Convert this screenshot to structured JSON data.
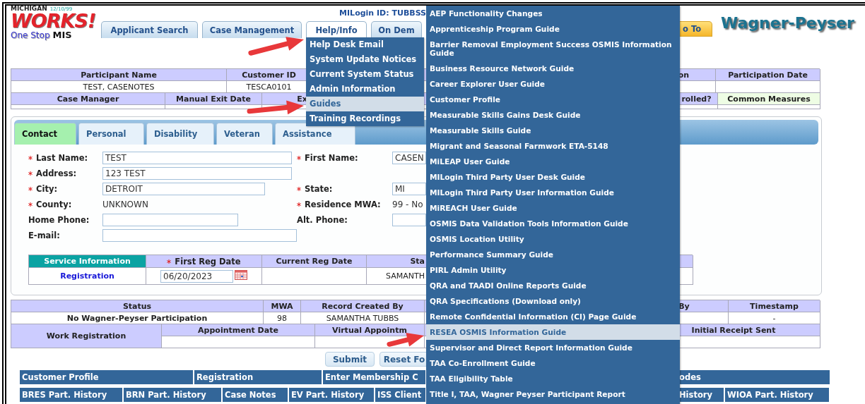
{
  "header": {
    "logo": {
      "state": "MICHIGAN",
      "version": "12/10/99",
      "brand": "WORKS!",
      "one_stop": "One Stop",
      "mis": "MIS"
    },
    "login_id": "MILogin ID: TUBBSS",
    "nav_tabs": [
      {
        "label": "Applicant Search",
        "selected": false
      },
      {
        "label": "Case Management",
        "selected": false
      },
      {
        "label": "Help/Info",
        "selected": true
      },
      {
        "label": "On Dem",
        "selected": false
      }
    ],
    "goto_button": "o To",
    "program_title": "Wagner-Peyser"
  },
  "participant_table": {
    "rows": [
      {
        "kind": "head",
        "cells": [
          "Participant Name",
          "Customer ID",
          "",
          "",
          "on",
          "Participation Date"
        ]
      },
      {
        "kind": "value",
        "cells": [
          "TEST, CASENOTES",
          "TESCA0101",
          "",
          "",
          "",
          ""
        ]
      },
      {
        "kind": "head",
        "cells": [
          "Case Manager",
          "Manual Exit Date",
          "Ex",
          "",
          "rolled?",
          {
            "text": "Common Measures",
            "highlight": true
          }
        ]
      },
      {
        "kind": "value",
        "cells": [
          "",
          "",
          "",
          "",
          "",
          ""
        ]
      }
    ]
  },
  "contact_tabs": [
    {
      "label": "Contact",
      "selected": true
    },
    {
      "label": "Personal",
      "selected": false
    },
    {
      "label": "Disability",
      "selected": false
    },
    {
      "label": "Veteran",
      "selected": false
    },
    {
      "label": "Assistance",
      "selected": false
    }
  ],
  "contact_form": [
    {
      "fields": [
        {
          "label": "Last Name:",
          "required": true,
          "kind": "input",
          "value": "TEST"
        },
        {
          "label": "First Name:",
          "required": true,
          "kind": "input",
          "value": "CASEN"
        }
      ]
    },
    {
      "fields": [
        {
          "label": "Address:",
          "required": true,
          "kind": "input",
          "value": "123 TEST"
        }
      ]
    },
    {
      "fields": [
        {
          "label": "City:",
          "required": true,
          "kind": "input",
          "value": "DETROIT"
        },
        {
          "label": "State:",
          "required": true,
          "kind": "input",
          "value": "MI"
        }
      ]
    },
    {
      "fields": [
        {
          "label": "County:",
          "required": true,
          "kind": "text",
          "value": "UNKNOWN"
        },
        {
          "label": "Residence MWA:",
          "required": true,
          "kind": "text",
          "value": "99 - No"
        }
      ]
    },
    {
      "fields": [
        {
          "label": "Home Phone:",
          "required": false,
          "kind": "input"
        },
        {
          "label": "Alt. Phone:",
          "required": false,
          "kind": "input"
        }
      ]
    },
    {
      "fields": [
        {
          "label": "E-mail:",
          "required": false,
          "kind": "input"
        }
      ]
    }
  ],
  "service_table": {
    "rows": [
      {
        "kind": "head",
        "cells": [
          {
            "text": "Service Information",
            "highlight": true
          },
          {
            "text": "First Reg Date",
            "required": true
          },
          "Current Reg Date",
          "Sta",
          ""
        ]
      },
      {
        "kind": "value",
        "cells": [
          {
            "text": "Registration",
            "kind": "link"
          },
          {
            "text": "06/20/2023",
            "kind": "date"
          },
          "",
          "SAMANTH",
          ""
        ]
      }
    ]
  },
  "status_table": {
    "rows": [
      {
        "kind": "head",
        "cells": [
          "Status",
          "MWA",
          "Record Created By",
          "",
          "By",
          "Timestamp"
        ]
      },
      {
        "kind": "value",
        "cells": [
          {
            "text": "No Wagner-Peyser Participation",
            "bold": true
          },
          "98",
          "SAMANTHA TUBBS",
          "",
          "",
          "-"
        ]
      }
    ]
  },
  "work_registration": {
    "label": "Work Registration",
    "headers_left": [
      "Appointment Date",
      "Virtual Appointm"
    ],
    "headers_right": [
      "Initial Receipt Sent"
    ]
  },
  "buttons": [
    "Submit",
    "Reset Fo"
  ],
  "nav_rows": [
    [
      "Customer Profile",
      "Registration",
      "Enter Membership C",
      "",
      "odes"
    ],
    [
      "BRES Part. History",
      "BRN Part. History",
      "Case Notes",
      "EV Part. History",
      "ISS Client",
      "",
      "History",
      "WIOA Part. History"
    ]
  ],
  "help_menu": [
    {
      "label": "Help Desk Email",
      "selected": false
    },
    {
      "label": "System Update Notices",
      "selected": false
    },
    {
      "label": "Current System Status",
      "selected": false
    },
    {
      "label": "Admin Information",
      "selected": false
    },
    {
      "label": "Guides",
      "selected": true
    },
    {
      "label": "Training Recordings",
      "selected": false
    }
  ],
  "guides_menu": [
    {
      "label": "AEP Functionality Changes",
      "selected": false
    },
    {
      "label": "Apprenticeship Program Guide",
      "selected": false
    },
    {
      "label": "Barrier Removal Employment Success OSMIS Information Guide",
      "selected": false
    },
    {
      "label": "Business Resource Network Guide",
      "selected": false
    },
    {
      "label": "Career Explorer User Guide",
      "selected": false
    },
    {
      "label": "Customer Profile",
      "selected": false
    },
    {
      "label": "Measurable Skills Gains Desk Guide",
      "selected": false
    },
    {
      "label": "Measurable Skills Guide",
      "selected": false
    },
    {
      "label": "Migrant and Seasonal Farmwork ETA-5148",
      "selected": false
    },
    {
      "label": "MiLEAP User Guide",
      "selected": false
    },
    {
      "label": "MILogin Third Party User Desk Guide",
      "selected": false
    },
    {
      "label": "MILogin Third Party User Information Guide",
      "selected": false
    },
    {
      "label": "MiREACH User Guide",
      "selected": false
    },
    {
      "label": "OSMIS Data Validation Tools Information Guide",
      "selected": false
    },
    {
      "label": "OSMIS Location Utility",
      "selected": false
    },
    {
      "label": "Performance Summary Guide",
      "selected": false
    },
    {
      "label": "PIRL Admin Utility",
      "selected": false
    },
    {
      "label": "QRA and TAADI Online Reports Guide",
      "selected": false
    },
    {
      "label": "QRA Specifications (Download only)",
      "selected": false
    },
    {
      "label": "Remote Confidential Information (CI) Page Guide",
      "selected": false
    },
    {
      "label": "RESEA OSMIS Information Guide",
      "selected": true
    },
    {
      "label": "Supervisor and Direct Report Information Guide",
      "selected": false
    },
    {
      "label": "TAA Co-Enrollment Guide",
      "selected": false
    },
    {
      "label": "TAA Eligibility Table",
      "selected": false
    },
    {
      "label": "Title I, TAA, Wagner Peyser Participant Report",
      "selected": false
    }
  ]
}
